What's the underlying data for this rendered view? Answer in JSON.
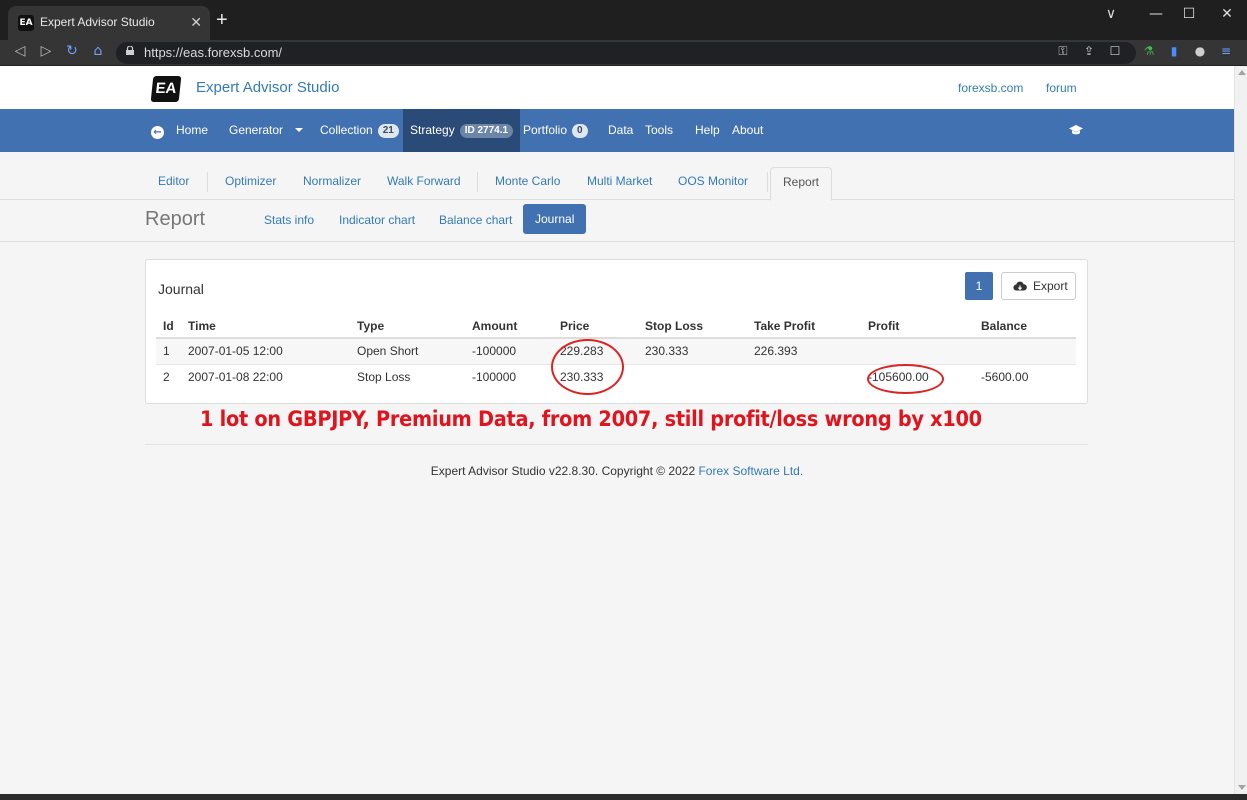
{
  "browser": {
    "tab_title": "Expert Advisor Studio",
    "tab_favicon": "EA",
    "url": "https://eas.forexsb.com/",
    "window_controls": [
      "∨",
      "—",
      "☐",
      "✕"
    ],
    "icons": [
      "back-icon",
      "forward-icon",
      "reload-icon",
      "home-icon",
      "lock-icon",
      "key-icon",
      "share-icon",
      "bookmark-icon",
      "flask-icon",
      "sidebar-icon",
      "profile-icon",
      "menu-icon"
    ]
  },
  "header": {
    "logo_text": "EA",
    "app_title": "Expert Advisor Studio",
    "links": [
      "forexsb.com",
      "forum"
    ]
  },
  "mainnav": {
    "home": "Home",
    "generator": "Generator",
    "collection": "Collection",
    "collection_badge": "21",
    "strategy": "Strategy",
    "strategy_badge": "ID 2774.1",
    "portfolio": "Portfolio",
    "portfolio_badge": "0",
    "data": "Data",
    "tools": "Tools",
    "help": "Help",
    "about": "About"
  },
  "subtabs": [
    "Editor",
    "Optimizer",
    "Normalizer",
    "Walk Forward",
    "Monte Carlo",
    "Multi Market",
    "OOS Monitor",
    "Report"
  ],
  "report": {
    "title": "Report",
    "tabs": [
      "Stats info",
      "Indicator chart",
      "Balance chart",
      "Journal"
    ],
    "active_tab": "Journal"
  },
  "journal": {
    "title": "Journal",
    "page": "1",
    "export_label": "Export",
    "columns": [
      "Id",
      "Time",
      "Type",
      "Amount",
      "Price",
      "Stop Loss",
      "Take Profit",
      "Profit",
      "Balance"
    ],
    "rows": [
      [
        "1",
        "2007-01-05 12:00",
        "Open Short",
        "-100000",
        "229.283",
        "230.333",
        "226.393",
        "",
        ""
      ],
      [
        "2",
        "2007-01-08 22:00",
        "Stop Loss",
        "-100000",
        "230.333",
        "",
        "",
        "-105600.00",
        "-5600.00"
      ]
    ]
  },
  "annotation": "1 lot on GBPJPY, Premium Data, from 2007, still profit/loss wrong by x100",
  "footer": {
    "text": "Expert Advisor Studio v22.8.30. Copyright © 2022",
    "link": "Forex Software Ltd."
  },
  "colors": {
    "nav_blue": "#4171b0",
    "nav_active": "#2a4a77",
    "link": "#337ab7",
    "annotation_red": "#e0141d"
  }
}
